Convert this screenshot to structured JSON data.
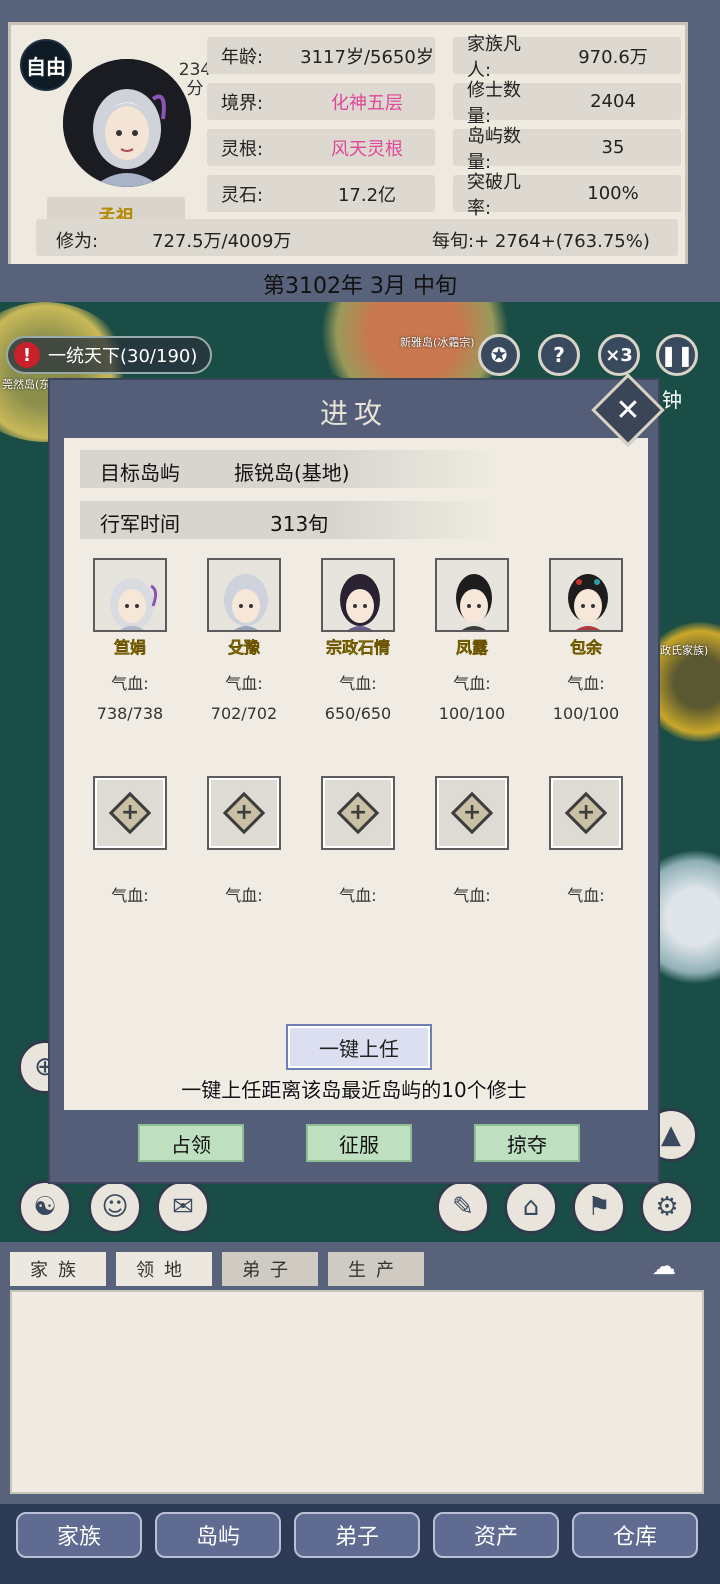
{
  "status": {
    "badge": "自由",
    "score": "234\n分",
    "player_name": "孟祖",
    "stats": [
      {
        "key": "年龄:",
        "value": "3117岁/5650岁",
        "pink": false
      },
      {
        "key": "家族凡人:",
        "value": "970.6万",
        "pink": false
      },
      {
        "key": "境界:",
        "value": "化神五层",
        "pink": true
      },
      {
        "key": "修士数量:",
        "value": "2404",
        "pink": false
      },
      {
        "key": "灵根:",
        "value": "风天灵根",
        "pink": true
      },
      {
        "key": "岛屿数量:",
        "value": "35",
        "pink": false
      },
      {
        "key": "灵石:",
        "value": "17.2亿",
        "pink": false
      },
      {
        "key": "突破几率:",
        "value": "100%",
        "pink": false
      }
    ],
    "cultivation_label": "修为:",
    "cultivation_value": "727.5万/4009万",
    "per_turn": "每旬:+ 2764+(763.75%)"
  },
  "date": "第3102年 3月 中旬",
  "map": {
    "quest_label": "一统天下(30/190)",
    "island_label_1": "新雅岛(冰霜宗)",
    "island_label_2": "莞然岛(东方氏家族)",
    "island_label_3": "政氏家族)",
    "speed_label": "×3",
    "side_word": "钟"
  },
  "dialog": {
    "title": "进攻",
    "target_label": "目标岛屿",
    "target_value": "振锐岛(基地)",
    "march_label": "行军时间",
    "march_value": "313旬",
    "hp_label": "气血:",
    "heroes": [
      {
        "name": "笪娟",
        "hp": "738/738"
      },
      {
        "name": "殳豫",
        "hp": "702/702"
      },
      {
        "name": "宗政石情",
        "hp": "650/650"
      },
      {
        "name": "凤露",
        "hp": "100/100"
      },
      {
        "name": "包余",
        "hp": "100/100"
      }
    ],
    "empty_slot_count_label": "气血:",
    "auto_button": "一键上任",
    "auto_hint": "一键上任距离该岛最近岛屿的10个修士",
    "actions": [
      "占领",
      "征服",
      "掠夺"
    ]
  },
  "log": {
    "tabs": [
      "家族",
      "领地",
      "弟子",
      "生产"
    ]
  },
  "nav": [
    "家族",
    "岛屿",
    "弟子",
    "资产",
    "仓库"
  ],
  "colors": {
    "frame": "#58627a",
    "panel": "#efeae0",
    "pink_value": "#e0479a",
    "hero_name": "#d8b400",
    "action_button": "#bfe0c0",
    "nav_button": "#5f6b91"
  }
}
